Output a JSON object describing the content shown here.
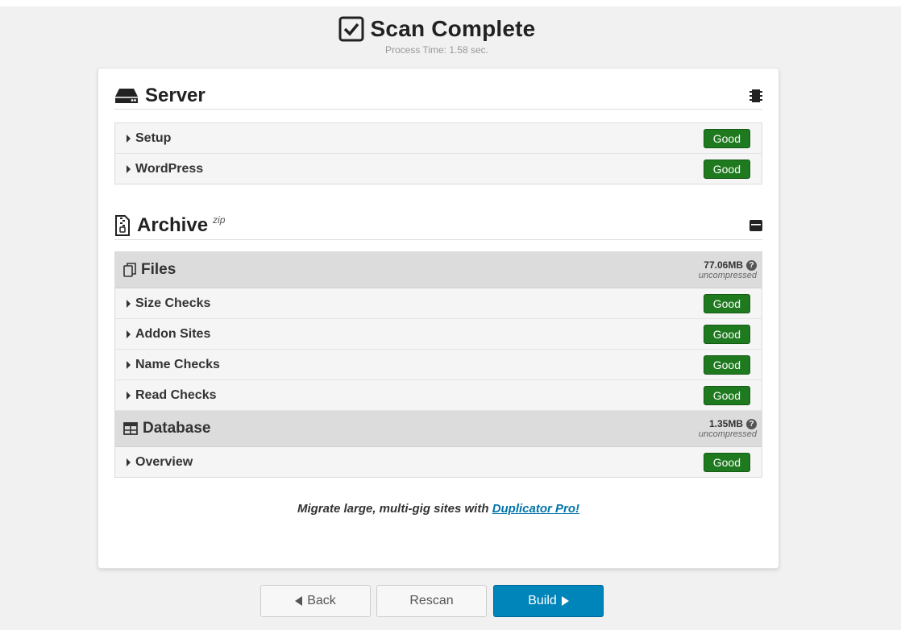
{
  "header": {
    "title": "Scan Complete",
    "process_time": "Process Time: 1.58 sec."
  },
  "server": {
    "title": "Server",
    "rows": [
      {
        "label": "Setup",
        "status": "Good"
      },
      {
        "label": "WordPress",
        "status": "Good"
      }
    ]
  },
  "archive": {
    "title": "Archive",
    "format": "zip",
    "files": {
      "title": "Files",
      "size": "77.06MB",
      "note": "uncompressed",
      "rows": [
        {
          "label": "Size Checks",
          "status": "Good"
        },
        {
          "label": "Addon Sites",
          "status": "Good"
        },
        {
          "label": "Name Checks",
          "status": "Good"
        },
        {
          "label": "Read Checks",
          "status": "Good"
        }
      ]
    },
    "database": {
      "title": "Database",
      "size": "1.35MB",
      "note": "uncompressed",
      "rows": [
        {
          "label": "Overview",
          "status": "Good"
        }
      ]
    }
  },
  "promo": {
    "text": "Migrate large, multi-gig sites with",
    "link": "Duplicator Pro!"
  },
  "buttons": {
    "back": "Back",
    "rescan": "Rescan",
    "build": "Build"
  },
  "colors": {
    "good": "#1f7a1f",
    "primary": "#0085ba",
    "link": "#0073aa"
  },
  "help_glyph": "?"
}
